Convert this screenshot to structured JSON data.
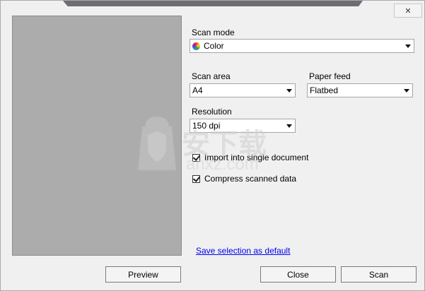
{
  "window": {
    "close_glyph": "✕"
  },
  "scan_mode": {
    "label": "Scan mode",
    "value": "Color"
  },
  "scan_area": {
    "label": "Scan area",
    "value": "A4"
  },
  "paper_feed": {
    "label": "Paper feed",
    "value": "Flatbed"
  },
  "resolution": {
    "label": "Resolution",
    "value": "150 dpi"
  },
  "options": {
    "import_single": {
      "label": "Import into single document",
      "checked": true
    },
    "compress": {
      "label": "Compress scanned data",
      "checked": true
    }
  },
  "link": {
    "save_default": "Save selection as default"
  },
  "buttons": {
    "preview": "Preview",
    "close": "Close",
    "scan": "Scan"
  },
  "watermark": {
    "text": "安下载",
    "sub": "anxz.com"
  },
  "colors": {
    "preview_bg": "#acacac",
    "link": "#0000ee",
    "titlebar": "#6d6d73"
  }
}
